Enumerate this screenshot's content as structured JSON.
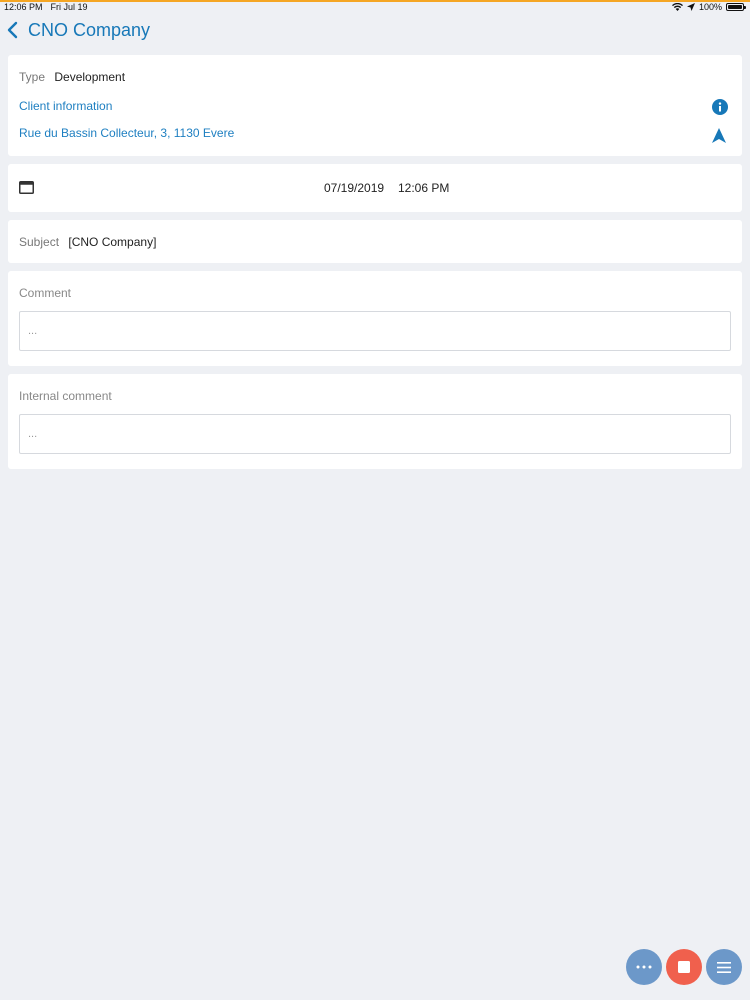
{
  "status_bar": {
    "time": "12:06 PM",
    "date": "Fri Jul 19",
    "battery": "100%"
  },
  "header": {
    "title": "CNO Company"
  },
  "info_card": {
    "type_label": "Type",
    "type_value": "Development",
    "client_info_link": "Client information",
    "address_link": "Rue du Bassin Collecteur, 3, 1130 Evere"
  },
  "schedule": {
    "date": "07/19/2019",
    "time": "12:06 PM"
  },
  "subject": {
    "label": "Subject",
    "value": "[CNO Company]"
  },
  "comment": {
    "label": "Comment",
    "placeholder": "..."
  },
  "internal_comment": {
    "label": "Internal comment",
    "placeholder": "..."
  },
  "colors": {
    "accent": "#1778b8",
    "link": "#1e7fc1",
    "fab_blue": "#6c98c9",
    "fab_red": "#f0604d",
    "status_orange": "#f5a623"
  }
}
